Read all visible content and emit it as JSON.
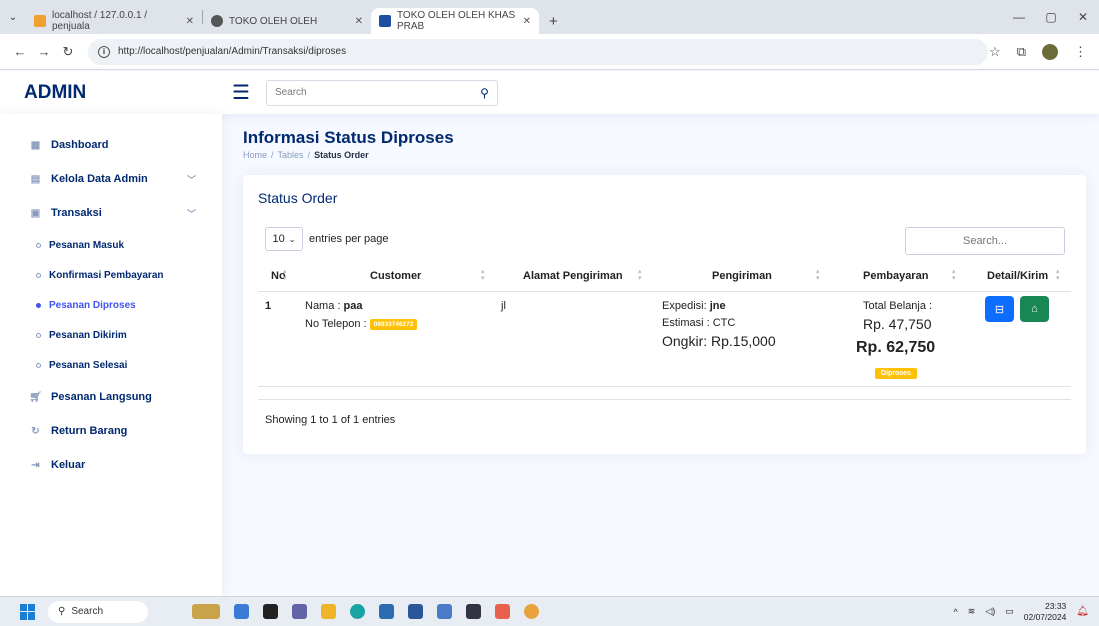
{
  "browser": {
    "tabs": [
      {
        "label": "localhost / 127.0.0.1 / penjuala",
        "active": false
      },
      {
        "label": "TOKO OLEH OLEH",
        "active": false
      },
      {
        "label": "TOKO OLEH OLEH KHAS PRAB",
        "active": true
      }
    ],
    "url": "http://localhost/penjualan/Admin/Transaksi/diproses"
  },
  "header": {
    "logo": "ADMIN",
    "search_placeholder": "Search"
  },
  "sidebar": {
    "items": [
      {
        "label": "Dashboard"
      },
      {
        "label": "Kelola Data Admin"
      },
      {
        "label": "Transaksi"
      }
    ],
    "subitems": [
      {
        "label": "Pesanan Masuk"
      },
      {
        "label": "Konfirmasi Pembayaran"
      },
      {
        "label": "Pesanan Diproses"
      },
      {
        "label": "Pesanan Dikirim"
      },
      {
        "label": "Pesanan Selesai"
      }
    ],
    "bottom_items": [
      {
        "label": "Pesanan Langsung"
      },
      {
        "label": "Return Barang"
      },
      {
        "label": "Keluar"
      }
    ]
  },
  "page": {
    "title": "Informasi Status Diproses",
    "breadcrumb": [
      "Home",
      "/",
      "Tables",
      "/",
      "Status Order"
    ]
  },
  "card": {
    "title": "Status Order",
    "per_page_value": "10",
    "per_page_label": "entries per page",
    "search_placeholder": "Search...",
    "columns": [
      "No",
      "Customer",
      "Alamat Pengiriman",
      "Pengiriman",
      "Pembayaran",
      "Detail/Kirim"
    ],
    "rows": [
      {
        "no": "1",
        "nama_label": "Nama :",
        "nama": "paa",
        "telepon_label": "No Telepon :",
        "telepon": "08933746272",
        "alamat": "jl",
        "expedisi_label": "Expedisi:",
        "expedisi": "jne",
        "estimasi": "Estimasi : CTC",
        "ongkir": "Ongkir: Rp.15,000",
        "total_label": "Total Belanja :",
        "total": "Rp. 47,750",
        "grand_total": "Rp. 62,750",
        "status": "Diproses"
      }
    ],
    "showing": "Showing 1 to 1 of 1 entries"
  },
  "taskbar": {
    "search": "Search",
    "time": "23:33",
    "date": "02/07/2024"
  },
  "colors": {
    "primary": "#4154f1",
    "navy": "#012970",
    "btn_blue": "#0d6efd",
    "btn_green": "#198754",
    "badge_yellow": "#ffc107"
  }
}
